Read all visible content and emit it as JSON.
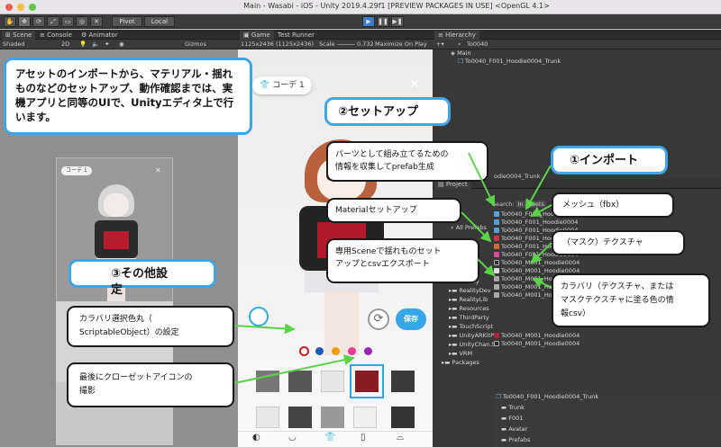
{
  "window": {
    "title": "Main - Wasabi - iOS - Unity 2019.4.29f1 [PREVIEW PACKAGES IN USE] <OpenGL 4.1>"
  },
  "toolbar": {
    "pivot_label": "Pivot",
    "local_label": "Local"
  },
  "scene_panel": {
    "tabs": [
      "Scene",
      "Console",
      "Animator"
    ],
    "shading_mode": "Shaded",
    "mode_2d": "2D",
    "gizmos_label": "Gizmos"
  },
  "game_panel": {
    "tabs": [
      "Game",
      "Test Runner"
    ],
    "resolution": "1125x2436 (1125x2436)",
    "scale_label": "Scale",
    "scale_value": "0.732",
    "maximize_label": "Maximize On Play",
    "coord_button": "コーデ 1",
    "save_label": "保存",
    "swatch_colors": [
      "#c81e1e",
      "#1e5ab4",
      "#f0a014",
      "#e63c96",
      "#9628b4"
    ]
  },
  "scene_view": {
    "coord_button": "コーデ 1"
  },
  "hierarchy": {
    "tab_label": "Hierarchy",
    "search_value": "To0040",
    "rows": [
      "Main",
      "To0040_F001_Hoodie0004_Trunk"
    ]
  },
  "project": {
    "tab_label": "Project",
    "search_label": "Search:",
    "in_assets_label": "In Assets",
    "header_path": "odie0004_Trunk",
    "all_prefabs_label": "All Prefabs",
    "folders": [
      "Reality",
      "RealityDev",
      "RealityLib",
      "Resources",
      "ThirdParty",
      "TouchScript",
      "UnityARKitPl",
      "UnityChan.S",
      "VRM",
      "Packages"
    ],
    "files": [
      "To0040_F001_Hoodie0004",
      "To0040_F001_Hoodie0004",
      "To0040_F001_Hoodie0004",
      "To0040_F001_Hoodie0004",
      "To0040_F001_Hoodie0004",
      "To0040_F001_Hoodie0004",
      "To0040_M001_Hoodie0004",
      "To0040_M001_Hoodie0004",
      "To0040_M001_Hoodie0",
      "To0040_M001_Hoodie0",
      "To0040_M001_Hoodie0",
      "To0040_M001_Hoodie0004",
      "To0040_M001_Hoodie0004"
    ],
    "bottom_rows": [
      "To0040_F001_Hoodie0004_Trunk",
      "Trunk",
      "F001",
      "Avatar",
      "Prefabs"
    ]
  },
  "callouts": {
    "intro": "アセットのインポートから、マテリアル・揺れものなどのセットアップ、動作確認までは、実機アプリと同等のUIで、Unityエディタ上で行います。",
    "setup_title": "②セットアップ",
    "import_title": "①インポート",
    "other_title": "③その他設定",
    "prefab": "パーツとして組み立てるための\n情報を収集してprefab生成",
    "material": "Materialセットアップ",
    "scene_csv": "専用Sceneで揺れものセット\nアップとcsvエクスポート",
    "mesh": "メッシュ（fbx）",
    "mask": "（マスク）テクスチャ",
    "color_variation": "カラバリ（テクスチャ、または\nマスクテクスチャに塗る色の情\n報csv）",
    "color_select": "カラバリ選択色丸（\nScriptableObject）の設定",
    "closet_icon": "最後にクローゼットアイコンの\n撮影"
  }
}
